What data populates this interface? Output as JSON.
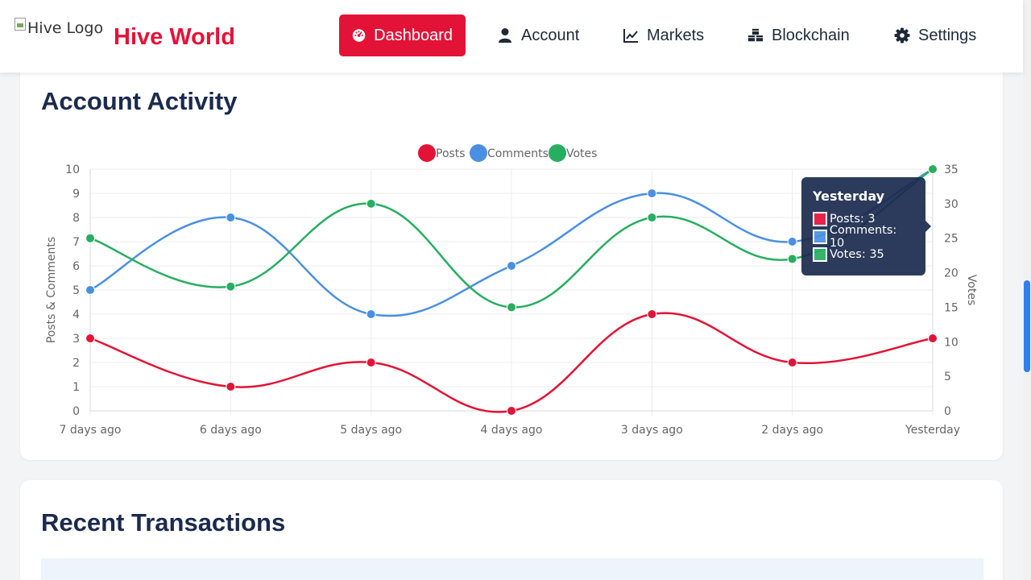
{
  "header": {
    "logo_alt": "Hive Logo",
    "brand": "Hive World",
    "nav": [
      {
        "label": "Dashboard",
        "icon": "dashboard-icon",
        "active": true
      },
      {
        "label": "Account",
        "icon": "user-icon",
        "active": false
      },
      {
        "label": "Markets",
        "icon": "line-chart-icon",
        "active": false
      },
      {
        "label": "Blockchain",
        "icon": "cubes-icon",
        "active": false
      },
      {
        "label": "Settings",
        "icon": "gear-icon",
        "active": false
      }
    ]
  },
  "activity": {
    "title": "Account Activity",
    "tooltip": {
      "title": "Yesterday",
      "rows": [
        "Posts: 3",
        "Comments: 10",
        "Votes: 35"
      ]
    }
  },
  "transactions": {
    "title": "Recent Transactions"
  },
  "colors": {
    "brand": "#e31337",
    "posts": "#e31337",
    "comments": "#4a90e2",
    "votes": "#27ae60",
    "heading": "#1b2a4e"
  },
  "chart_data": {
    "type": "line",
    "categories": [
      "7 days ago",
      "6 days ago",
      "5 days ago",
      "4 days ago",
      "3 days ago",
      "2 days ago",
      "Yesterday"
    ],
    "series": [
      {
        "name": "Posts",
        "axis": "left",
        "values": [
          3,
          1,
          2,
          0,
          4,
          2,
          3
        ]
      },
      {
        "name": "Comments",
        "axis": "left",
        "values": [
          5,
          8,
          4,
          6,
          9,
          7,
          10
        ]
      },
      {
        "name": "Votes",
        "axis": "right",
        "values": [
          25,
          18,
          30,
          15,
          28,
          22,
          35
        ]
      }
    ],
    "ylabel": "Posts & Comments",
    "y2label": "Votes",
    "ylim": [
      0,
      10
    ],
    "y2lim": [
      0,
      35
    ],
    "yticks": [
      0,
      1,
      2,
      3,
      4,
      5,
      6,
      7,
      8,
      9,
      10
    ],
    "y2ticks": [
      0,
      5,
      10,
      15,
      20,
      25,
      30,
      35
    ],
    "legend": "top",
    "grid": true
  }
}
